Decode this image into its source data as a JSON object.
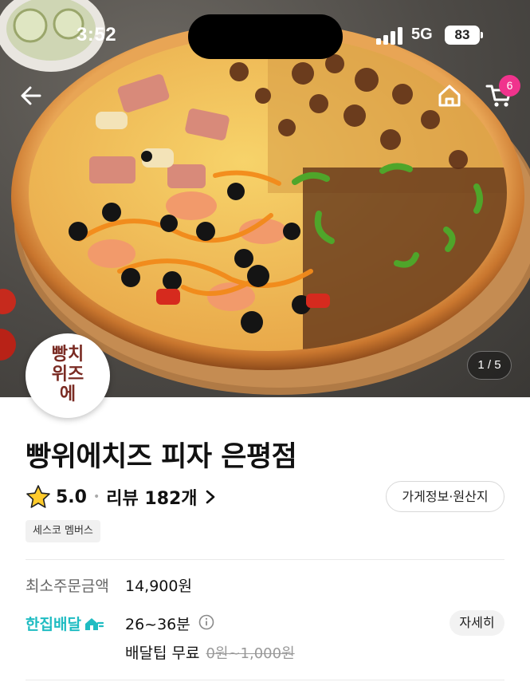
{
  "status_bar": {
    "time": "3:52",
    "network": "5G",
    "battery": "83"
  },
  "nav": {
    "cart_count": "6"
  },
  "hero": {
    "page_indicator": "1 / 5"
  },
  "logo": {
    "text": "빵치위즈에"
  },
  "store": {
    "name": "빵위에치즈 피자 은평점",
    "rating": "5.0",
    "separator": "•",
    "review_label": "리뷰 182개",
    "info_button": "가게정보·원산지",
    "membership_badge": "세스코 멤버스"
  },
  "order": {
    "min_order_label": "최소주문금액",
    "min_order_value": "14,900원",
    "delivery_brand": "한집배달",
    "delivery_time": "26~36분",
    "detail_button": "자세히",
    "tip_label": "배달팁 무료",
    "tip_original": "0원~1,000원"
  },
  "colors": {
    "accent_cyan": "#1fbcc2",
    "badge_pink": "#f0338d",
    "logo_brown": "#7a2b23"
  },
  "icons": [
    "back-arrow-icon",
    "home-icon",
    "cart-icon",
    "star-icon",
    "chevron-right-icon",
    "info-icon",
    "delivery-icon"
  ]
}
